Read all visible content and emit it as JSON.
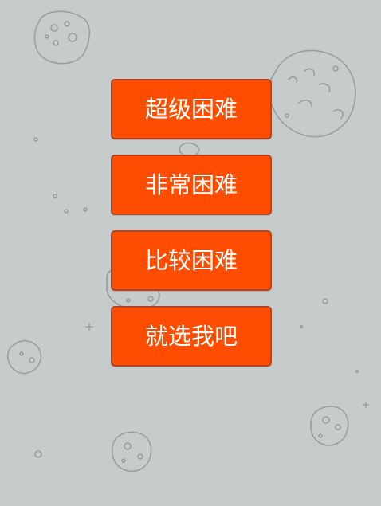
{
  "menu": {
    "buttons": [
      "超级困难",
      "非常困难",
      "比较困难",
      "就选我吧"
    ]
  },
  "colors": {
    "background": "#c6cbcb",
    "button": "#ff4d00",
    "button_border": "#b24324",
    "button_text": "#ffffff",
    "sketch": "#999999"
  },
  "decorations": {
    "background_icons": [
      "rock-sketch-icon",
      "cookie-sketch-icon",
      "crater-sketch-icon",
      "small-pebble-icon",
      "sparkle-icon"
    ]
  }
}
